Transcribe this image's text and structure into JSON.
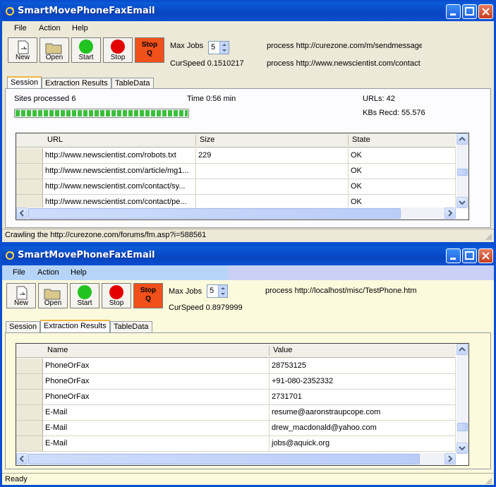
{
  "app": {
    "title": "SmartMovePhoneFaxEmail"
  },
  "menu": [
    "File",
    "Action",
    "Help"
  ],
  "toolbar": {
    "new_label": "New",
    "open_label": "Open",
    "start_label": "Start",
    "stop_label": "Stop",
    "stopq_label": "Stop Q",
    "maxjobs_label": "Max Jobs",
    "maxjobs_value": "5"
  },
  "tabs": [
    "Session",
    "Extraction Results",
    "TableData"
  ],
  "colors": {
    "title_bar": "#0a4fd0",
    "start_green": "#21c321",
    "stop_red": "#e30000",
    "stopq_orange": "#f0501a",
    "progress_green": "#3bbf3b",
    "cream_bg": "#fcfadc"
  },
  "top": {
    "curspeed": "CurSpeed 0.1510217",
    "process_lines": [
      "process http://curezone.com/m/sendmessage",
      "process http://www.newscientist.com/contact"
    ],
    "sites_processed": "Sites processed 6",
    "time": "Time 0:56 min",
    "urls": "URLs: 42",
    "kbs_recd": "KBs Recd: 55.576",
    "progress_fraction": 1.0,
    "grid": {
      "headers": [
        "URL",
        "Size",
        "State"
      ],
      "rows": [
        [
          "http://www.newscientist.com/robots.txt",
          "229",
          "OK"
        ],
        [
          "http://www.newscientist.com/article/mg1...",
          "",
          "OK"
        ],
        [
          "http://www.newscientist.com/contact/sy...",
          "",
          "OK"
        ],
        [
          "http://www.newscientist.com/contact/pe...",
          "",
          "OK"
        ]
      ]
    },
    "status": "Crawling the http://curezone.com/forums/fm.asp?i=588561"
  },
  "bottom": {
    "curspeed": "CurSpeed 0.8979999",
    "process_line": "process http://localhost/misc/TestPhone.htm",
    "grid": {
      "headers": [
        "Name",
        "Value"
      ],
      "rows": [
        [
          "PhoneOrFax",
          "28753125"
        ],
        [
          "PhoneOrFax",
          "+91-080-2352332"
        ],
        [
          "PhoneOrFax",
          "2731701"
        ],
        [
          "E-Mail",
          "resume@aaronstraupcope.com"
        ],
        [
          "E-Mail",
          "drew_macdonald@yahoo.com"
        ],
        [
          "E-Mail",
          "jobs@aquick.org"
        ]
      ]
    },
    "status": "Ready"
  }
}
